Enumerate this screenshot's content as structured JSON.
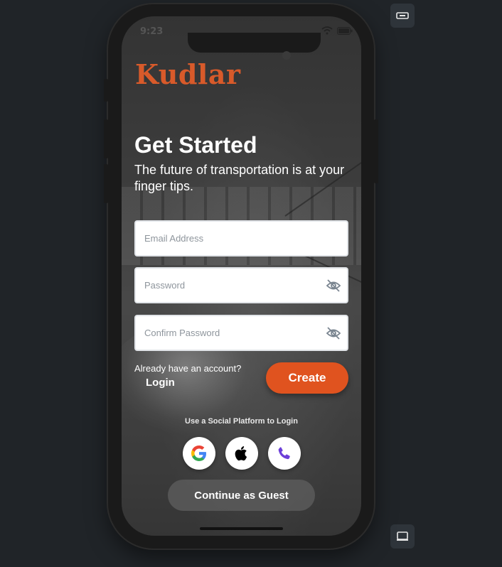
{
  "status": {
    "time": "9:23"
  },
  "brand": {
    "logo": "Kudlar",
    "accent": "#e0531f"
  },
  "header": {
    "title": "Get Started",
    "subtitle": "The future of transportation is at your finger tips."
  },
  "form": {
    "email_placeholder": "Email Address",
    "password_placeholder": "Password",
    "confirm_placeholder": "Confirm Password"
  },
  "account": {
    "prompt": "Already have an account?",
    "login_label": "Login",
    "create_label": "Create"
  },
  "social": {
    "label": "Use a Social Platform to Login",
    "icons": [
      "google-icon",
      "apple-icon",
      "phone-icon"
    ]
  },
  "guest": {
    "label": "Continue as Guest"
  },
  "icons": {
    "eye_off": "eye-off-icon",
    "top_tool": "minimize-icon",
    "bottom_tool": "laptop-icon"
  }
}
